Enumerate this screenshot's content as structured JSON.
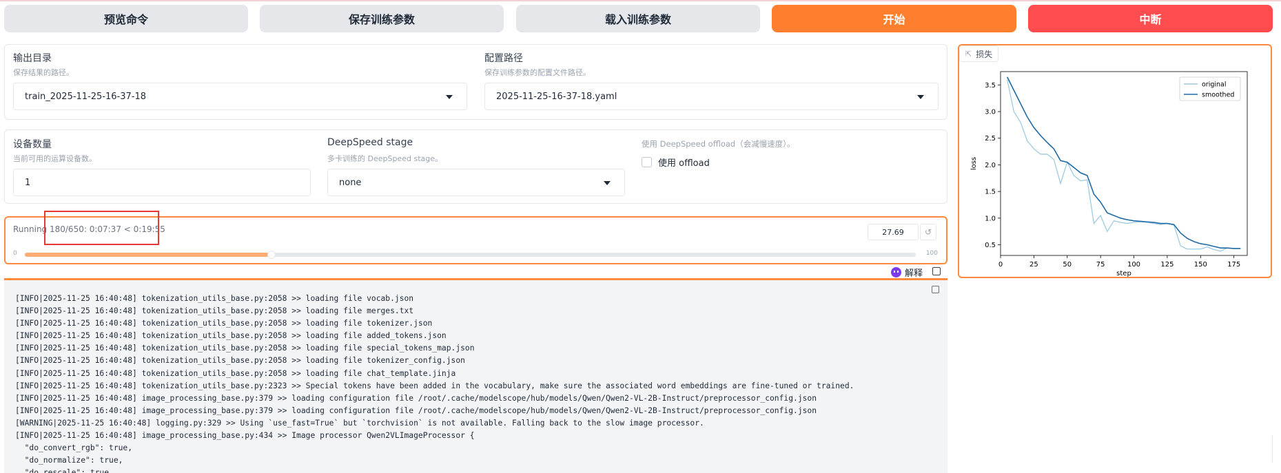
{
  "buttons": {
    "preview": "预览命令",
    "save": "保存训练参数",
    "load": "载入训练参数",
    "start": "开始",
    "abort": "中断"
  },
  "output_dir": {
    "label": "输出目录",
    "info": "保存结果的路径。",
    "value": "train_2025-11-25-16-37-18"
  },
  "config_path": {
    "label": "配置路径",
    "info": "保存训练参数的配置文件路径。",
    "value": "2025-11-25-16-37-18.yaml"
  },
  "device_count": {
    "label": "设备数量",
    "info": "当前可用的运算设备数。",
    "value": "1"
  },
  "deepspeed_stage": {
    "label": "DeepSpeed stage",
    "info": "多卡训练的 DeepSpeed stage。",
    "value": "none"
  },
  "deepspeed_offload": {
    "info": "使用 DeepSpeed offload（会减慢速度）。",
    "checkbox_label": "使用 offload"
  },
  "progress": {
    "status": "Running 180/650: 0:07:37 < 0:19:55",
    "value": "27.69",
    "min_label": "0",
    "max_label": "100",
    "percent": 27.69
  },
  "explain_label": "解释",
  "log_lines": [
    "[INFO|2025-11-25 16:40:48] tokenization_utils_base.py:2058 >> loading file vocab.json",
    "[INFO|2025-11-25 16:40:48] tokenization_utils_base.py:2058 >> loading file merges.txt",
    "[INFO|2025-11-25 16:40:48] tokenization_utils_base.py:2058 >> loading file tokenizer.json",
    "[INFO|2025-11-25 16:40:48] tokenization_utils_base.py:2058 >> loading file added_tokens.json",
    "[INFO|2025-11-25 16:40:48] tokenization_utils_base.py:2058 >> loading file special_tokens_map.json",
    "[INFO|2025-11-25 16:40:48] tokenization_utils_base.py:2058 >> loading file tokenizer_config.json",
    "[INFO|2025-11-25 16:40:48] tokenization_utils_base.py:2058 >> loading file chat_template.jinja",
    "[INFO|2025-11-25 16:40:48] tokenization_utils_base.py:2323 >> Special tokens have been added in the vocabulary, make sure the associated word embeddings are fine-tuned or trained.",
    "[INFO|2025-11-25 16:40:48] image_processing_base.py:379 >> loading configuration file /root/.cache/modelscope/hub/models/Qwen/Qwen2-VL-2B-Instruct/preprocessor_config.json",
    "[INFO|2025-11-25 16:40:48] image_processing_base.py:379 >> loading configuration file /root/.cache/modelscope/hub/models/Qwen/Qwen2-VL-2B-Instruct/preprocessor_config.json",
    "[WARNING|2025-11-25 16:40:48] logging.py:329 >> Using `use_fast=True` but `torchvision` is not available. Falling back to the slow image processor.",
    "[INFO|2025-11-25 16:40:48] image_processing_base.py:434 >> Image processor Qwen2VLImageProcessor {",
    "  \"do_convert_rgb\": true,",
    "  \"do_normalize\": true,",
    "  \"do_rescale\": true,"
  ],
  "chart_tab_label": "损失",
  "chart_data": {
    "type": "line",
    "xlabel": "step",
    "ylabel": "loss",
    "xlim": [
      0,
      185
    ],
    "ylim": [
      0.3,
      3.75
    ],
    "xticks": [
      0,
      25,
      50,
      75,
      100,
      125,
      150,
      175
    ],
    "yticks": [
      0.5,
      1.0,
      1.5,
      2.0,
      2.5,
      3.0,
      3.5
    ],
    "legend": "top-right",
    "series": [
      {
        "name": "original",
        "color": "#9ecae1",
        "x": [
          5,
          10,
          15,
          20,
          25,
          30,
          35,
          40,
          45,
          50,
          55,
          60,
          65,
          70,
          75,
          80,
          85,
          90,
          95,
          100,
          105,
          110,
          115,
          120,
          125,
          130,
          135,
          140,
          145,
          150,
          155,
          160,
          165,
          170,
          175,
          180
        ],
        "y": [
          3.6,
          3.0,
          2.8,
          2.45,
          2.3,
          2.2,
          2.2,
          2.1,
          1.65,
          2.05,
          1.8,
          1.7,
          1.72,
          0.9,
          1.05,
          0.75,
          0.95,
          0.92,
          0.9,
          0.92,
          0.93,
          0.92,
          0.9,
          0.88,
          0.9,
          0.87,
          0.48,
          0.42,
          0.42,
          0.42,
          0.46,
          0.41,
          0.38,
          0.44,
          0.43,
          0.43
        ]
      },
      {
        "name": "smoothed",
        "color": "#1f6aa5",
        "x": [
          5,
          10,
          15,
          20,
          25,
          30,
          35,
          40,
          45,
          50,
          55,
          60,
          65,
          70,
          75,
          80,
          85,
          90,
          95,
          100,
          105,
          110,
          115,
          120,
          125,
          130,
          135,
          140,
          145,
          150,
          155,
          160,
          165,
          170,
          175,
          180
        ],
        "y": [
          3.65,
          3.4,
          3.15,
          2.9,
          2.7,
          2.55,
          2.42,
          2.3,
          2.08,
          2.05,
          1.95,
          1.85,
          1.8,
          1.45,
          1.3,
          1.1,
          1.05,
          1.0,
          0.97,
          0.95,
          0.94,
          0.93,
          0.92,
          0.9,
          0.9,
          0.88,
          0.72,
          0.62,
          0.56,
          0.52,
          0.5,
          0.47,
          0.44,
          0.44,
          0.43,
          0.43
        ]
      }
    ]
  }
}
